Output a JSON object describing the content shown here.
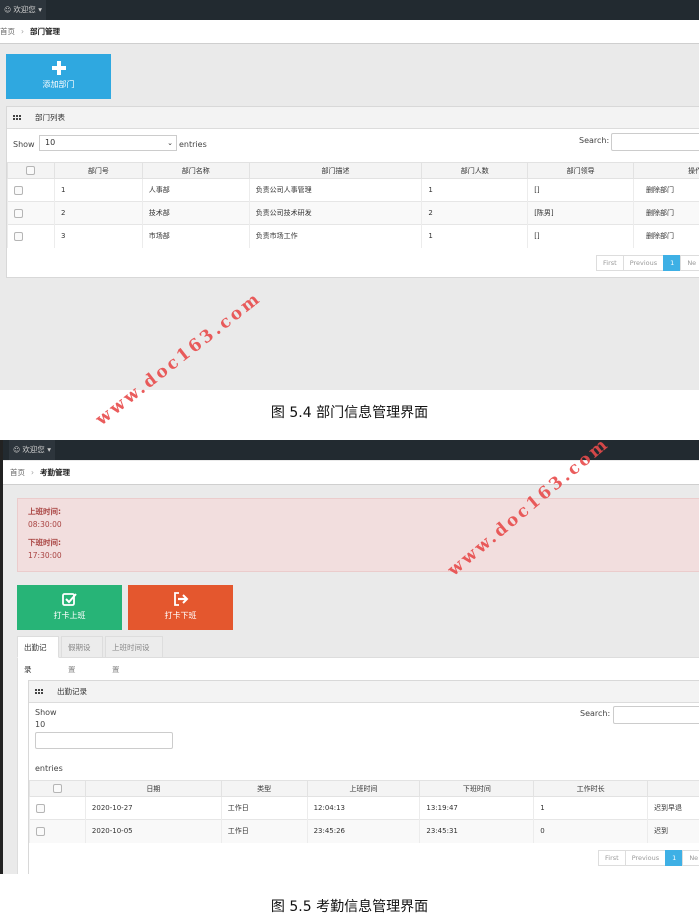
{
  "shot1": {
    "topbar": {
      "welcome": "欢迎您"
    },
    "breadcrumb": {
      "home": "首页",
      "current": "部门管理"
    },
    "add_button": {
      "label": "添加部门",
      "color": "#2fa8e0"
    },
    "panel_title": "部门列表",
    "length": {
      "show": "Show",
      "value": "10",
      "entries": "entries"
    },
    "search_label": "Search:",
    "columns": [
      "",
      "部门号",
      "部门名称",
      "部门描述",
      "部门人数",
      "部门领导",
      "操作"
    ],
    "rows": [
      {
        "id": "1",
        "name": "人事部",
        "desc": "负责公司人事管理",
        "count": "1",
        "leader": "[]",
        "action": "删除部门"
      },
      {
        "id": "2",
        "name": "技术部",
        "desc": "负责公司技术研发",
        "count": "2",
        "leader": "[陈男]",
        "action": "删除部门"
      },
      {
        "id": "3",
        "name": "市场部",
        "desc": "负责市场工作",
        "count": "1",
        "leader": "[]",
        "action": "删除部门"
      }
    ],
    "pager": {
      "first": "First",
      "previous": "Previous",
      "page": "1",
      "next": "Ne"
    }
  },
  "caption1": "图 5.4 部门信息管理界面",
  "shot2": {
    "topbar": {
      "welcome": "欢迎您"
    },
    "breadcrumb": {
      "home": "首页",
      "current": "考勤管理"
    },
    "alert": {
      "start_label": "上班时间:",
      "start_value": "08:30:00",
      "end_label": "下班时间:",
      "end_value": "17:30:00",
      "color": "#a94442"
    },
    "checkin_button": {
      "label": "打卡上班",
      "color": "#27b477"
    },
    "checkout_button": {
      "label": "打卡下班",
      "color": "#e4572e"
    },
    "tabs": [
      "出勤记录",
      "假期设置",
      "上班时间设置"
    ],
    "panel_title": "出勤记录",
    "length": {
      "show": "Show",
      "value": "10",
      "entries": "entries"
    },
    "search_label": "Search:",
    "columns": [
      "",
      "日期",
      "类型",
      "上班时间",
      "下班时间",
      "工作时长",
      "备"
    ],
    "rows": [
      {
        "date": "2020-10-27",
        "type": "工作日",
        "start": "12:04:13",
        "end": "13:19:47",
        "hours": "1",
        "note": "迟到早退"
      },
      {
        "date": "2020-10-05",
        "type": "工作日",
        "start": "23:45:26",
        "end": "23:45:31",
        "hours": "0",
        "note": "迟到"
      }
    ],
    "pager": {
      "first": "First",
      "previous": "Previous",
      "page": "1",
      "next": "Ne"
    }
  },
  "caption2": "图 5.5 考勤信息管理界面",
  "watermark": "www.doc163.com"
}
